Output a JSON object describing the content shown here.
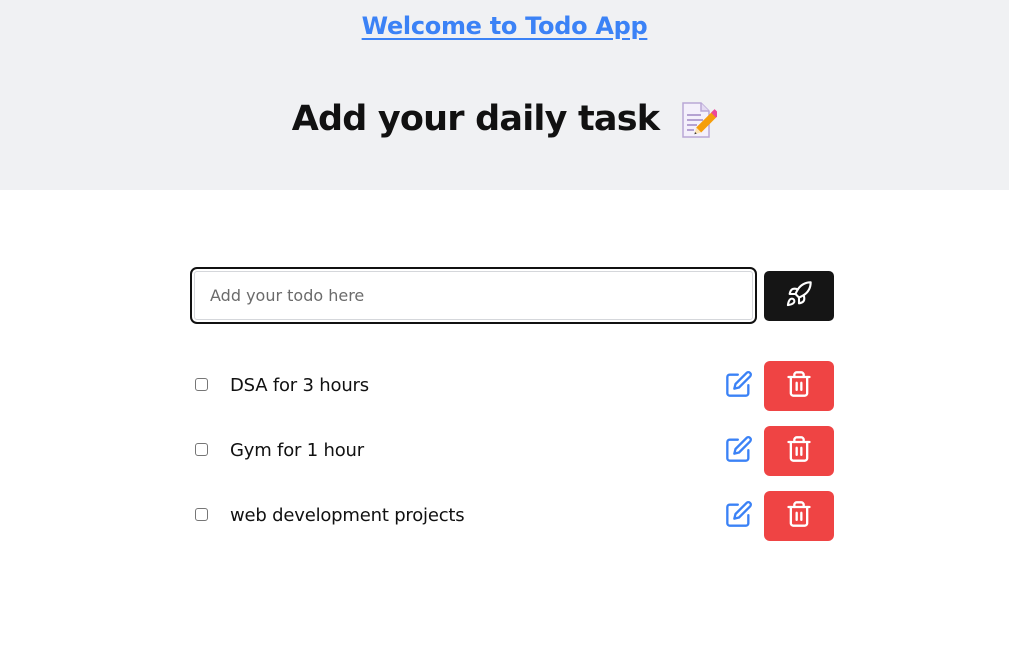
{
  "header": {
    "welcome_text": "Welcome to Todo App",
    "title": "Add your daily task",
    "title_icon": "memo-icon"
  },
  "add_form": {
    "input_placeholder": "Add your todo here",
    "input_value": "",
    "submit_icon": "rocket-icon"
  },
  "todos": [
    {
      "text": "DSA for 3 hours",
      "checked": false
    },
    {
      "text": "Gym for 1 hour",
      "checked": false
    },
    {
      "text": "web development projects",
      "checked": false
    }
  ],
  "actions": {
    "edit_icon": "edit-icon",
    "delete_icon": "trash-icon"
  },
  "colors": {
    "header_bg": "#f0f1f3",
    "link": "#3b82f6",
    "add_button": "#151515",
    "delete_button": "#ef4444",
    "edit_icon": "#3b82f6"
  }
}
